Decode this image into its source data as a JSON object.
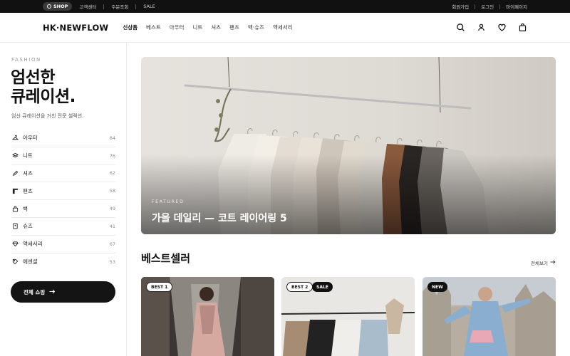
{
  "topbar": {
    "shop_label": "SHOP",
    "links": [
      "고객센터",
      "주문조회",
      "SALE"
    ],
    "right_links": [
      "회원가입",
      "로그인",
      "마이페이지"
    ]
  },
  "header": {
    "logo": "HK·NEWFLOW",
    "nav": [
      {
        "label": "신상품",
        "active": true
      },
      {
        "label": "베스트"
      },
      {
        "label": "아우터"
      },
      {
        "label": "니트"
      },
      {
        "label": "셔츠"
      },
      {
        "label": "팬츠"
      },
      {
        "label": "백·슈즈"
      },
      {
        "label": "액세서리"
      }
    ],
    "icons": [
      "search-icon",
      "user-icon",
      "heart-icon",
      "bag-icon"
    ]
  },
  "sidebar": {
    "eyebrow": "FASHION",
    "title_line1": "엄선한",
    "title_line2": "큐레이션.",
    "subtitle": "엄선 큐레이션을 거친 전문 셀렉션.",
    "categories": [
      {
        "label": "아우터",
        "count": "84",
        "icon": "hanger-icon"
      },
      {
        "label": "니트",
        "count": "76",
        "icon": "layers-icon"
      },
      {
        "label": "셔츠",
        "count": "62",
        "icon": "pen-icon"
      },
      {
        "label": "팬츠",
        "count": "58",
        "icon": "pants-icon"
      },
      {
        "label": "백",
        "count": "49",
        "icon": "bag-icon"
      },
      {
        "label": "슈즈",
        "count": "41",
        "icon": "shoe-icon"
      },
      {
        "label": "액세서리",
        "count": "67",
        "icon": "gem-icon"
      },
      {
        "label": "에센셜",
        "count": "53",
        "icon": "tag-icon"
      }
    ],
    "all_button": "전체 쇼핑"
  },
  "banner": {
    "label": "FEATURED",
    "title": "가을 데일리 — 코트 레이어링 5"
  },
  "bestsellers": {
    "title": "베스트셀러",
    "view_all": "전체보기",
    "cards": [
      {
        "badges": [
          {
            "text": "BEST 1",
            "style": "light"
          }
        ]
      },
      {
        "badges": [
          {
            "text": "BEST 2",
            "style": "light"
          },
          {
            "text": "SALE",
            "style": "dark"
          }
        ]
      },
      {
        "badges": [
          {
            "text": "NEW",
            "style": "dark"
          }
        ]
      }
    ]
  }
}
